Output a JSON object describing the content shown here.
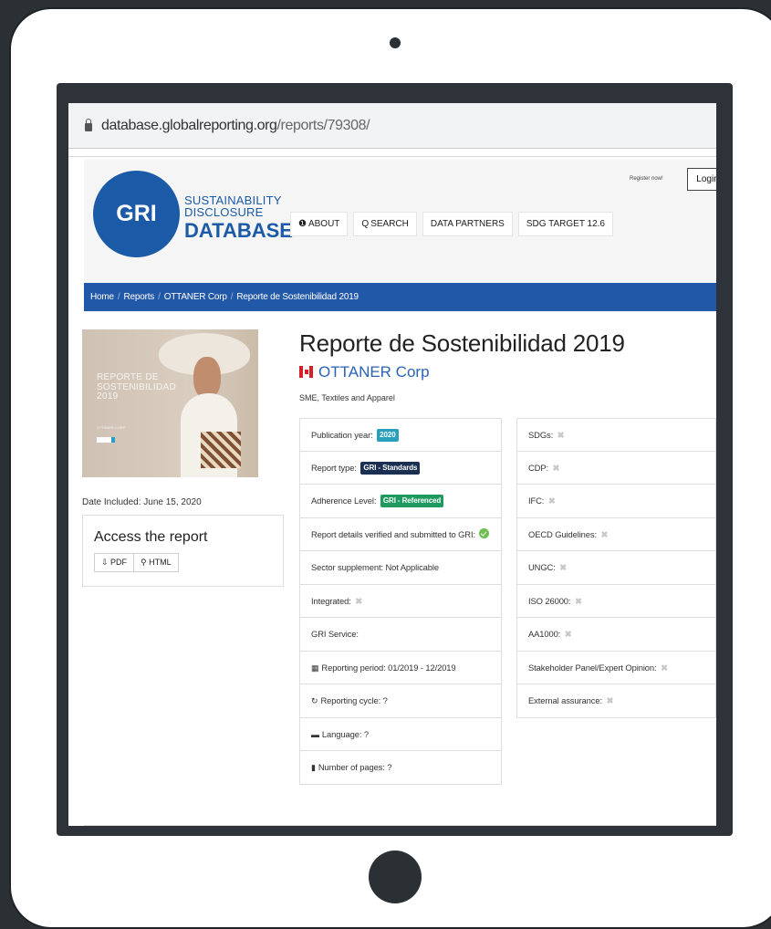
{
  "browser": {
    "url_domain": "database.globalreporting.org",
    "url_path": "/reports/79308/"
  },
  "header": {
    "logo_abbr": "GRI",
    "logo_line1": "SUSTAINABILITY",
    "logo_line2": "DISCLOSURE",
    "logo_line3": "DATABASE",
    "nav": {
      "about_icon": "❶",
      "about_label": "ABOUT",
      "search_icon": "🔍",
      "search_label": "SEARCH",
      "data_partners_label": "DATA PARTNERS",
      "sdg_label": "SDG TARGET 12.6"
    },
    "register_label": "Register now!",
    "login_label": "Login"
  },
  "breadcrumb": {
    "home": "Home",
    "sep": "/",
    "reports": "Reports",
    "company": "OTTANER Corp",
    "current": "Reporte de Sostenibilidad 2019"
  },
  "cover": {
    "title_line1": "REPORTE DE",
    "title_line2": "SOSTENIBILIDAD",
    "title_line3": "2019",
    "small_text": "OTTANER CORP"
  },
  "sidebar": {
    "date_included": "Date Included: June 15, 2020",
    "access_title": "Access the report",
    "pdf_label": "PDF",
    "html_label": "HTML"
  },
  "report": {
    "title": "Reporte de Sostenibilidad 2019",
    "company": "OTTANER Corp",
    "sector": "SME, Textiles and Apparel"
  },
  "details_left": {
    "publication_year_label": "Publication year:",
    "publication_year_value": "2020",
    "report_type_label": "Report type:",
    "report_type_value": "GRI - Standards",
    "adherence_label": "Adherence Level:",
    "adherence_value": "GRI - Referenced",
    "verified_label": "Report details verified and submitted to GRI:",
    "sector_supplement": "Sector supplement: Not Applicable",
    "integrated_label": "Integrated:",
    "gri_service_label": "GRI Service:",
    "reporting_period": "Reporting period: 01/2019 - 12/2019",
    "reporting_cycle": "Reporting cycle: ?",
    "language": "Language: ?",
    "number_of_pages": "Number of pages: ?"
  },
  "details_right": {
    "sdgs": "SDGs:",
    "cdp": "CDP:",
    "ifc": "IFC:",
    "oecd": "OECD Guidelines:",
    "ungc": "UNGC:",
    "iso": "ISO 26000:",
    "aa1000": "AA1000:",
    "stakeholder": "Stakeholder Panel/Expert Opinion:",
    "external": "External assurance:"
  },
  "cross_glyph": "✖"
}
